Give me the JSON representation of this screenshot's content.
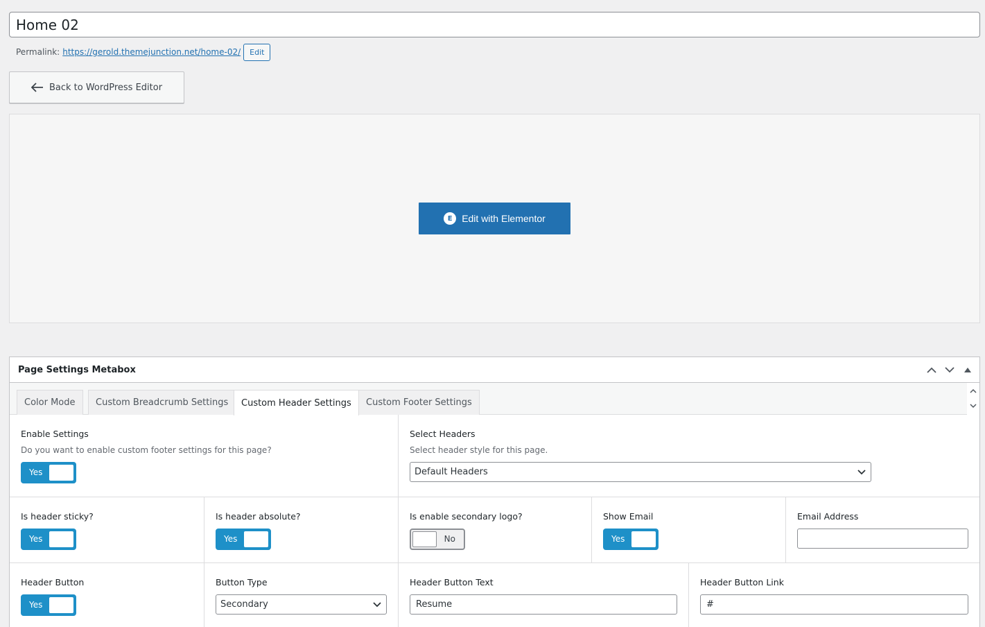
{
  "title": {
    "value": "Home 02"
  },
  "permalink": {
    "label": "Permalink:",
    "url_base": "https://gerold.themejunction.net/",
    "slug": "home-02",
    "url_tail": "/",
    "edit_label": "Edit"
  },
  "back_button": {
    "label": "Back to WordPress Editor"
  },
  "elementor": {
    "button_label": "Edit with Elementor"
  },
  "metabox": {
    "title": "Page Settings Metabox",
    "tabs": [
      {
        "label": "Color Mode"
      },
      {
        "label": "Custom Breadcrumb Settings"
      },
      {
        "label": "Custom Header Settings"
      },
      {
        "label": "Custom Footer Settings"
      }
    ],
    "active_tab": "Custom Header Settings"
  },
  "fields": {
    "enable_settings": {
      "label": "Enable Settings",
      "desc": "Do you want to enable custom footer settings for this page?",
      "toggle_text": "Yes"
    },
    "select_headers": {
      "label": "Select Headers",
      "desc": "Select header style for this page.",
      "value": "Default Headers"
    },
    "header_sticky": {
      "label": "Is header sticky?",
      "toggle_text": "Yes"
    },
    "header_absolute": {
      "label": "Is header absolute?",
      "toggle_text": "Yes"
    },
    "secondary_logo": {
      "label": "Is enable secondary logo?",
      "toggle_text": "No"
    },
    "show_email": {
      "label": "Show Email",
      "toggle_text": "Yes"
    },
    "email_address": {
      "label": "Email Address",
      "value": ""
    },
    "header_button": {
      "label": "Header Button",
      "toggle_text": "Yes"
    },
    "button_type": {
      "label": "Button Type",
      "value": "Secondary"
    },
    "button_text": {
      "label": "Header Button Text",
      "value": "Resume"
    },
    "button_link": {
      "label": "Header Button Link",
      "value": "#"
    }
  },
  "colors": {
    "accent": "#2271b1",
    "toggle_on": "#1e90c8"
  }
}
